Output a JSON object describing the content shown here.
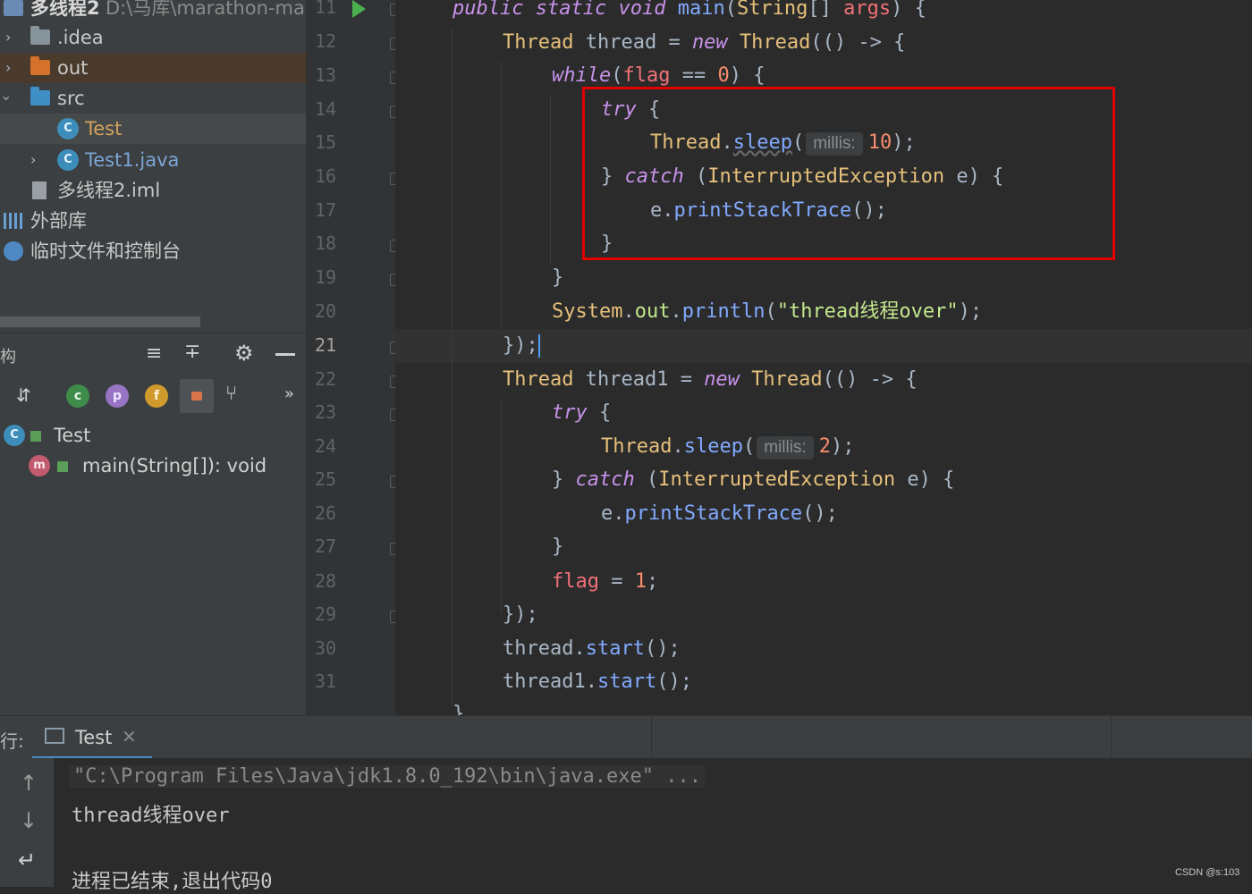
{
  "project_header": {
    "name": "多线程2",
    "path": "D:\\马库\\marathon-marc"
  },
  "project_tree": [
    {
      "label": ".idea",
      "type": "folder",
      "expanded": false
    },
    {
      "label": "out",
      "type": "folder-excluded",
      "expanded": false
    },
    {
      "label": "src",
      "type": "source-folder",
      "expanded": true
    },
    {
      "label": "Test",
      "type": "class"
    },
    {
      "label": "Test1.java",
      "type": "class"
    },
    {
      "label": "多线程2.iml",
      "type": "module-file"
    },
    {
      "label": "外部库",
      "type": "libraries"
    },
    {
      "label": "临时文件和控制台",
      "type": "scratches"
    }
  ],
  "structure": {
    "title_fragment": "构",
    "toolbar_icons": [
      "expand-all-icon",
      "collapse-all-icon",
      "gear-icon",
      "minimize-icon"
    ],
    "filter_icons": [
      "sort-alpha-icon",
      "inherited-icon",
      "property-icon",
      "field-icon",
      "lock-icon",
      "anonymous-icon",
      "more-icon"
    ],
    "tree": [
      {
        "label": "Test",
        "kind": "class"
      },
      {
        "label": "main(String[]): void",
        "kind": "method"
      }
    ]
  },
  "editor": {
    "line_numbers": [
      "11",
      "12",
      "13",
      "14",
      "15",
      "16",
      "17",
      "18",
      "19",
      "20",
      "21",
      "22",
      "23",
      "24",
      "25",
      "26",
      "27",
      "28",
      "29",
      "30",
      "31"
    ],
    "hint_label": "millis:",
    "sleep_values": [
      "10",
      "2"
    ],
    "string_literal": "\"thread线程over\"",
    "flag_value": "1",
    "flag_compare": "0"
  },
  "run": {
    "label": "行:",
    "tab": "Test",
    "console": [
      "\"C:\\Program Files\\Java\\jdk1.8.0_192\\bin\\java.exe\" ...",
      "thread线程over",
      "",
      "进程已结束,退出代码0"
    ]
  },
  "watermark": "CSDN @s:103",
  "colors": {
    "highlight_box": "#e00000",
    "keyword": "#c792ea",
    "method": "#82aaff",
    "type": "#e6c07b",
    "number": "#f78c6c",
    "string": "#c3e88d",
    "variable": "#f07178"
  }
}
